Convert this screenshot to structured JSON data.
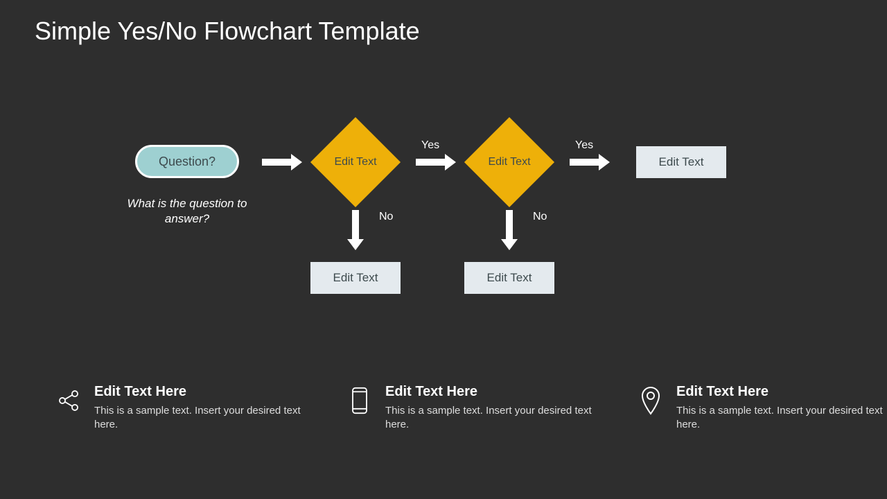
{
  "title": "Simple Yes/No Flowchart Template",
  "flow": {
    "start": "Question?",
    "start_sub": "What is the question to answer?",
    "d1": "Edit Text",
    "d2": "Edit Text",
    "end": "Edit Text",
    "no1": "Edit Text",
    "no2": "Edit Text",
    "yes_label": "Yes",
    "no_label": "No"
  },
  "features": [
    {
      "heading": "Edit Text Here",
      "body": "This is a sample text. Insert your desired text here."
    },
    {
      "heading": "Edit Text Here",
      "body": "This is a sample text. Insert your desired text here."
    },
    {
      "heading": "Edit Text Here",
      "body": "This is a sample text. Insert your desired text here."
    }
  ]
}
